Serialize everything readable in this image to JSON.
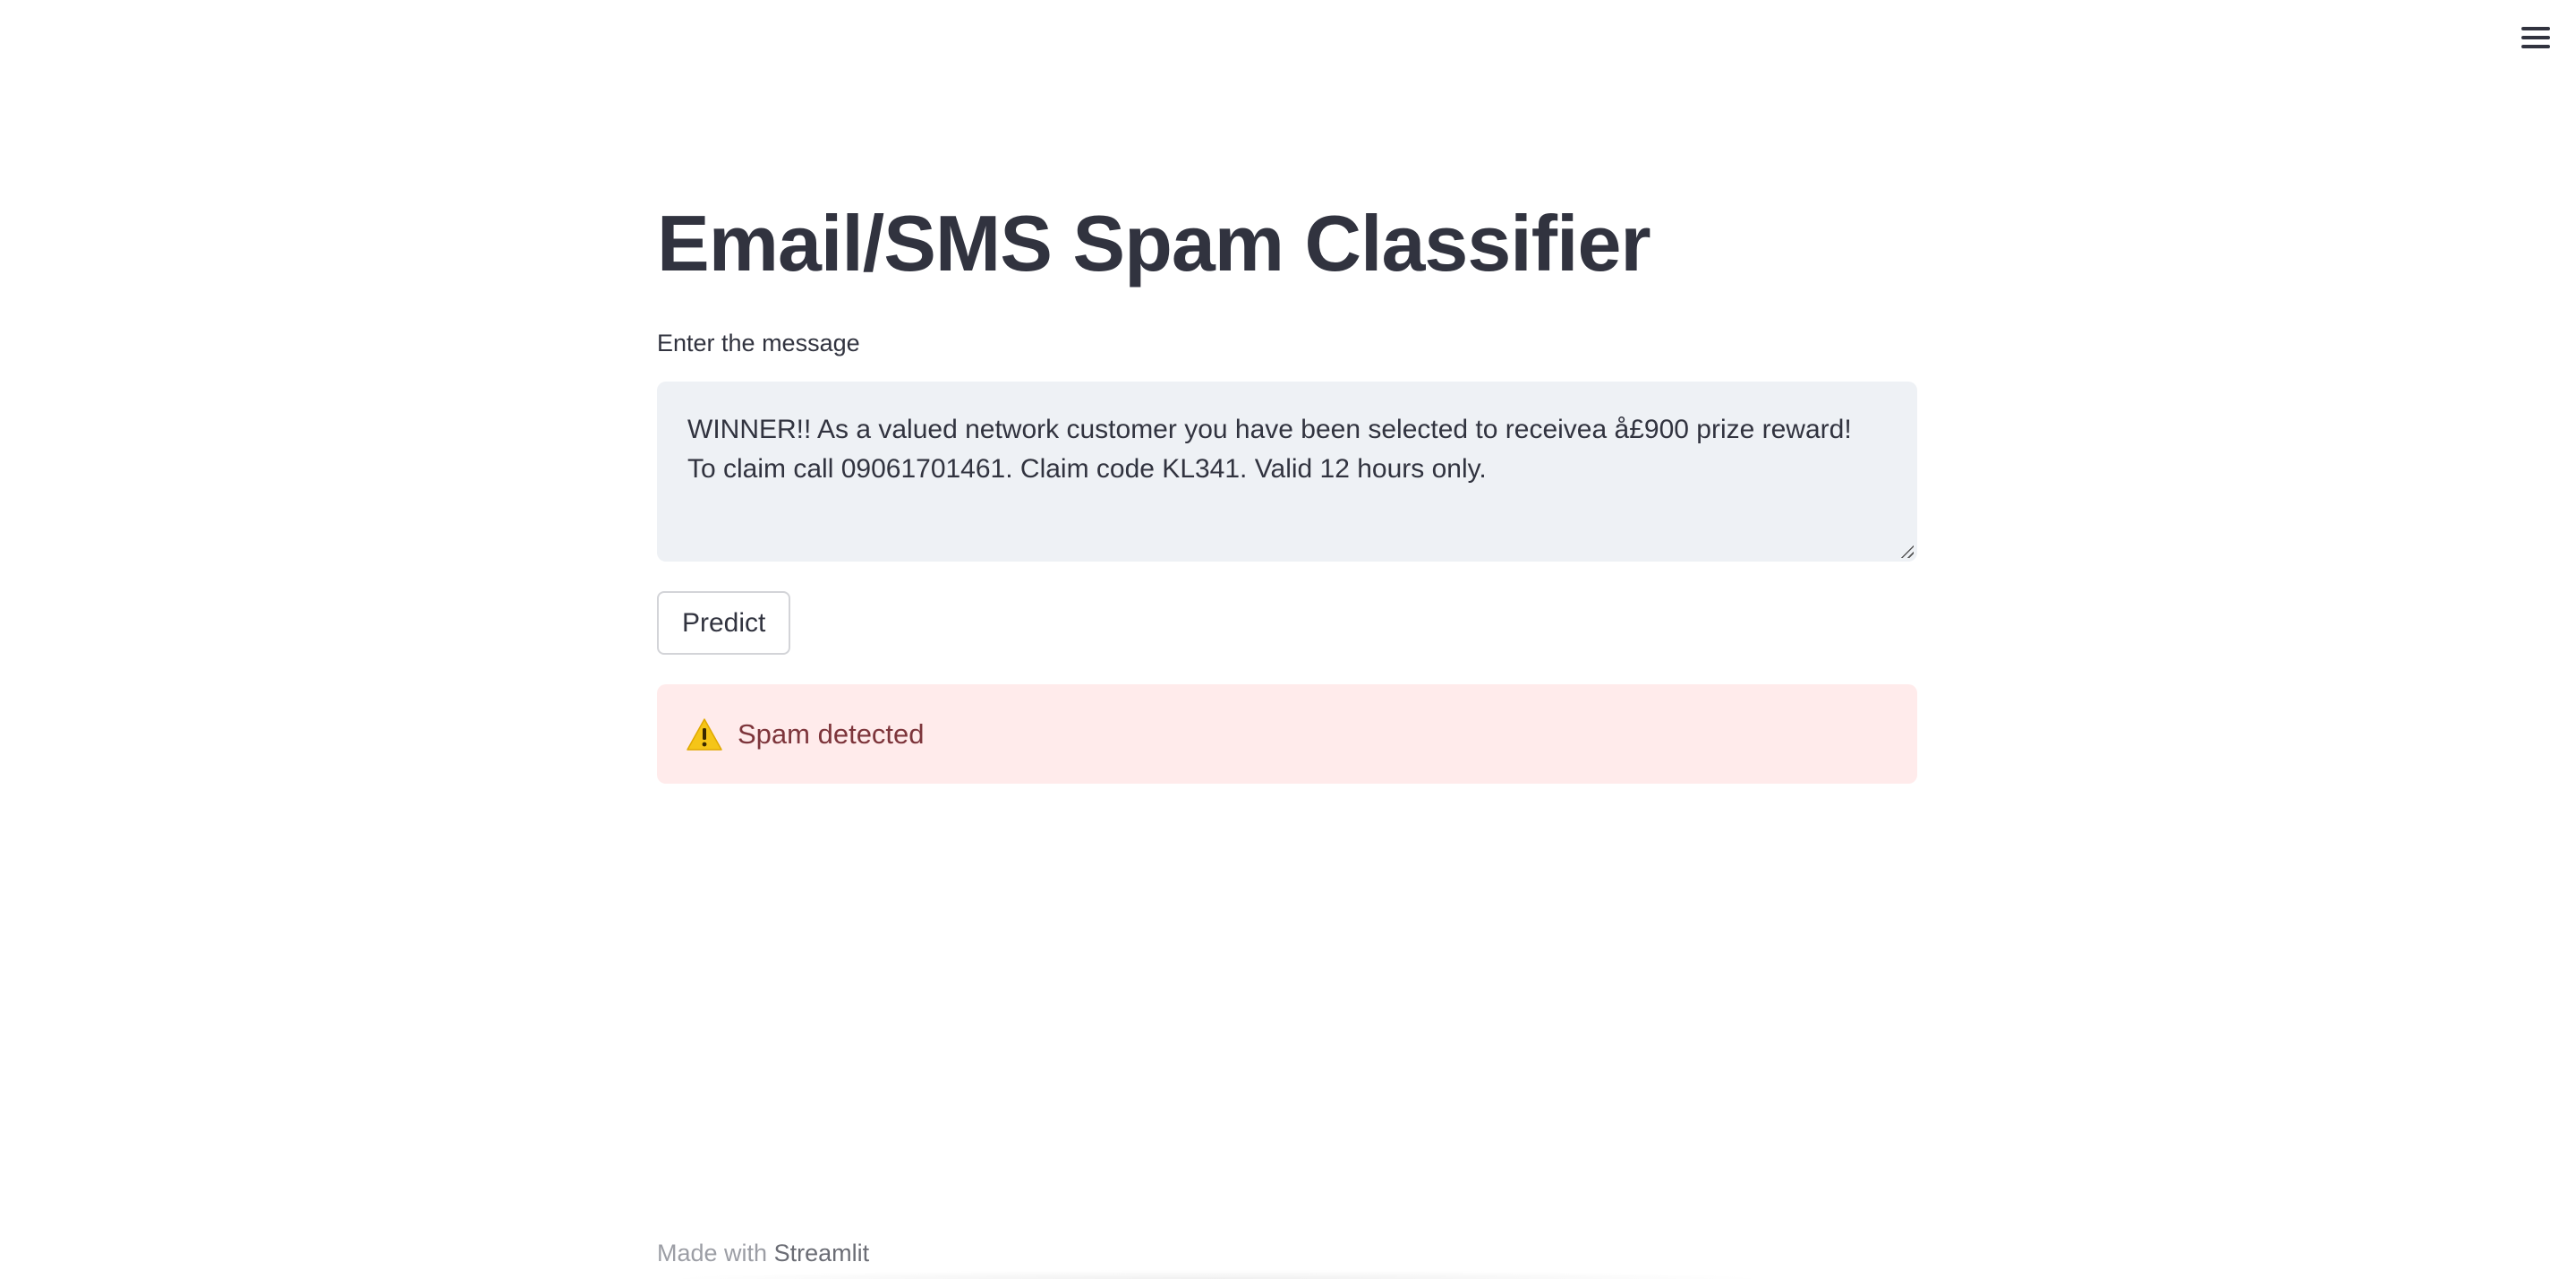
{
  "header": {
    "menu_icon": "hamburger-menu-icon"
  },
  "main": {
    "title": "Email/SMS Spam Classifier",
    "input_label": "Enter the message",
    "message": "WINNER!! As a valued network customer you have been selected to receivea å£900 prize reward! To claim call 09061701461. Claim code KL341. Valid 12 hours only.",
    "predict_label": "Predict",
    "result": {
      "icon": "warning-icon",
      "text": "Spam detected"
    }
  },
  "footer": {
    "prefix": "Made with",
    "brand": "Streamlit"
  },
  "colors": {
    "text": "#31333f",
    "input_background": "#eef1f5",
    "alert_background": "#ffebeb",
    "alert_text": "#7d353b",
    "warning_icon": "#f5c518"
  }
}
